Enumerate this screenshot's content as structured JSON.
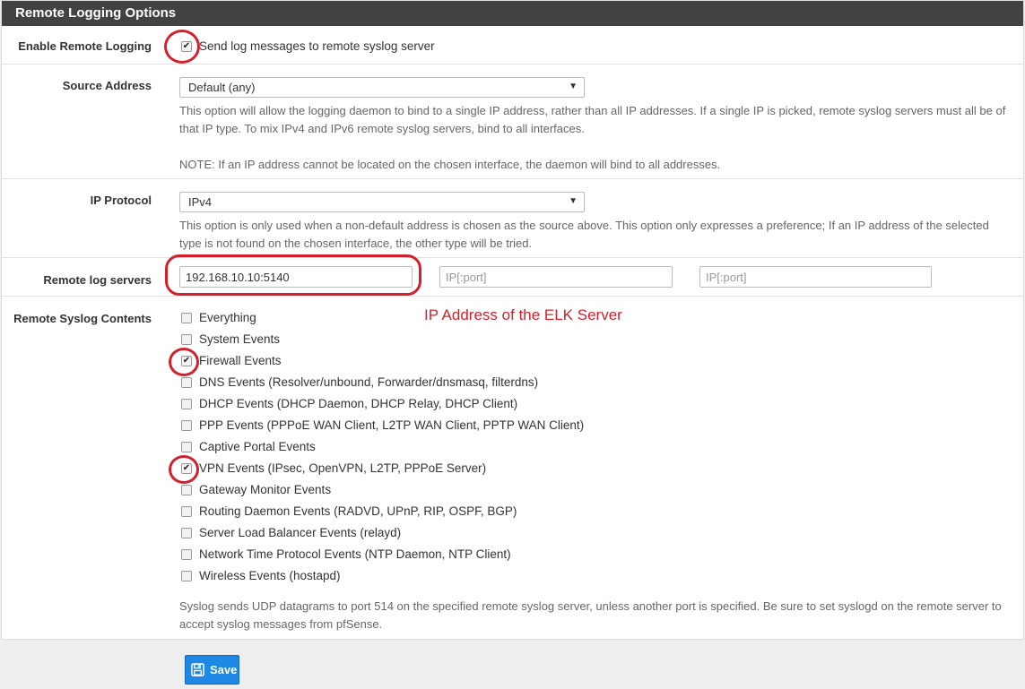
{
  "panel": {
    "title": "Remote Logging Options"
  },
  "enable": {
    "label": "Enable Remote Logging",
    "checkbox_text": "Send log messages to remote syslog server",
    "checked": true
  },
  "source": {
    "label": "Source Address",
    "selected": "Default (any)",
    "help1": "This option will allow the logging daemon to bind to a single IP address, rather than all IP addresses. If a single IP is picked, remote syslog servers must all be of that IP type. To mix IPv4 and IPv6 remote syslog servers, bind to all interfaces.",
    "help2": "NOTE: If an IP address cannot be located on the chosen interface, the daemon will bind to all addresses."
  },
  "protocol": {
    "label": "IP Protocol",
    "selected": "IPv4",
    "help": "This option is only used when a non-default address is chosen as the source above. This option only expresses a preference; If an IP address of the selected type is not found on the chosen interface, the other type will be tried."
  },
  "servers": {
    "label": "Remote log servers",
    "server1": "192.168.10.10:5140",
    "server2_placeholder": "IP[:port]",
    "server3_placeholder": "IP[:port]"
  },
  "annotation": "IP Address of the ELK Server",
  "contents": {
    "label": "Remote Syslog Contents",
    "items": [
      {
        "label": "Everything",
        "checked": false
      },
      {
        "label": "System Events",
        "checked": false
      },
      {
        "label": "Firewall Events",
        "checked": true
      },
      {
        "label": "DNS Events (Resolver/unbound, Forwarder/dnsmasq, filterdns)",
        "checked": false
      },
      {
        "label": "DHCP Events (DHCP Daemon, DHCP Relay, DHCP Client)",
        "checked": false
      },
      {
        "label": "PPP Events (PPPoE WAN Client, L2TP WAN Client, PPTP WAN Client)",
        "checked": false
      },
      {
        "label": "Captive Portal Events",
        "checked": false
      },
      {
        "label": "VPN Events (IPsec, OpenVPN, L2TP, PPPoE Server)",
        "checked": true
      },
      {
        "label": "Gateway Monitor Events",
        "checked": false
      },
      {
        "label": "Routing Daemon Events (RADVD, UPnP, RIP, OSPF, BGP)",
        "checked": false
      },
      {
        "label": "Server Load Balancer Events (relayd)",
        "checked": false
      },
      {
        "label": "Network Time Protocol Events (NTP Daemon, NTP Client)",
        "checked": false
      },
      {
        "label": "Wireless Events (hostapd)",
        "checked": false
      }
    ],
    "help": "Syslog sends UDP datagrams to port 514 on the specified remote syslog server, unless another port is specified. Be sure to set syslogd on the remote server to accept syslog messages from pfSense."
  },
  "save": {
    "label": "Save",
    "icon": "save-icon"
  },
  "colors": {
    "header": "#424242",
    "annotation": "#d4202c",
    "button": "#1e88e5"
  }
}
